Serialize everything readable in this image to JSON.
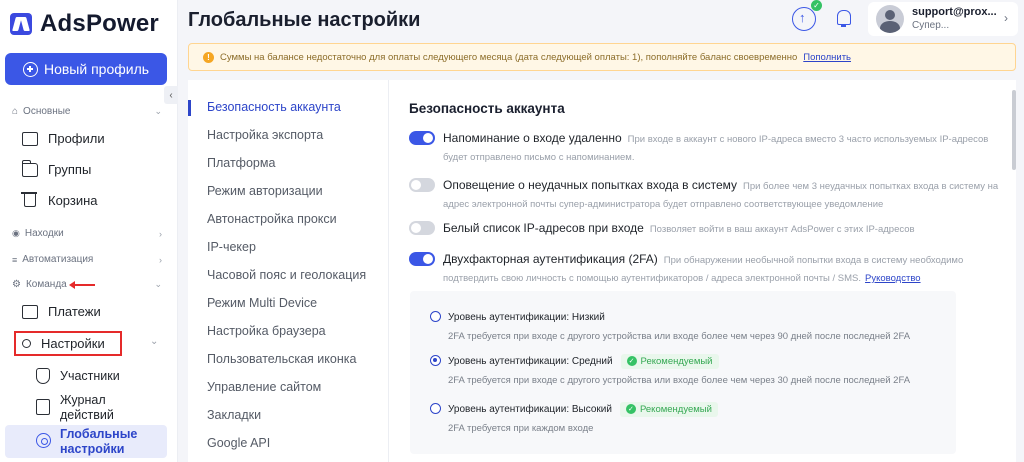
{
  "brand": {
    "name": "AdsPower"
  },
  "sidebar": {
    "new_profile": "Новый профиль",
    "sections": [
      {
        "label": "Основные"
      },
      {
        "label": "Находки"
      },
      {
        "label": "Автоматизация"
      },
      {
        "label": "Команда"
      }
    ],
    "items": {
      "profiles": "Профили",
      "groups": "Группы",
      "trash": "Корзина",
      "payments": "Платежи",
      "settings": "Настройки",
      "members": "Участники",
      "action_log": "Журнал действий",
      "global_settings": "Глобальные настройки"
    }
  },
  "header": {
    "title": "Глобальные настройки",
    "account": {
      "email": "support@prox...",
      "role": "Супер..."
    }
  },
  "warning": {
    "text": "Суммы на балансе недостаточно для оплаты следующего месяца (дата следующей оплаты: 1), пополняйте баланс своевременно",
    "link": "Пополнить"
  },
  "settings_nav": [
    "Безопасность аккаунта",
    "Настройка экспорта",
    "Платформа",
    "Режим авторизации",
    "Автонастройка прокси",
    "IP-чекер",
    "Часовой пояс и геолокация",
    "Режим Multi Device",
    "Настройка браузера",
    "Пользовательская иконка",
    "Управление сайтом",
    "Закладки",
    "Google API"
  ],
  "content": {
    "title": "Безопасность аккаунта",
    "settings": [
      {
        "title": "Напоминание о входе удаленно",
        "enabled": true,
        "desc": "При входе в аккаунт с нового IP-адреса вместо 3 часто используемых IP-адресов будет отправлено письмо с напоминанием."
      },
      {
        "title": "Оповещение о неудачных попытках входа в систему",
        "enabled": false,
        "desc": "При более чем 3 неудачных попытках входа в систему на адрес электронной почты супер-администратора будет отправлено соответствующее уведомление"
      },
      {
        "title": "Белый список IP-адресов при входе",
        "enabled": false,
        "desc": "Позволяет войти в ваш аккаунт AdsPower с этих IP-адресов"
      },
      {
        "title": "Двухфакторная аутентификация (2FA)",
        "enabled": true,
        "desc": "При обнаружении необычной попытки входа в систему необходимо подтвердить свою личность с помощью аутентификаторов / адреса электронной почты / SMS.",
        "link": "Руководство"
      }
    ],
    "twofa_levels": [
      {
        "label": "Уровень аутентификации: Низкий",
        "recommended": false,
        "selected": false,
        "desc": "2FA требуется при входе с другого устройства или входе более чем через 90 дней после последней 2FA"
      },
      {
        "label": "Уровень аутентификации: Средний",
        "recommended": true,
        "selected": true,
        "desc": "2FA требуется при входе с другого устройства или входе более чем через 30 дней после последней 2FA"
      },
      {
        "label": "Уровень аутентификации: Высокий",
        "recommended": true,
        "selected": false,
        "desc": "2FA требуется при каждом входе"
      }
    ],
    "recommended_label": "Рекомендуемый"
  }
}
